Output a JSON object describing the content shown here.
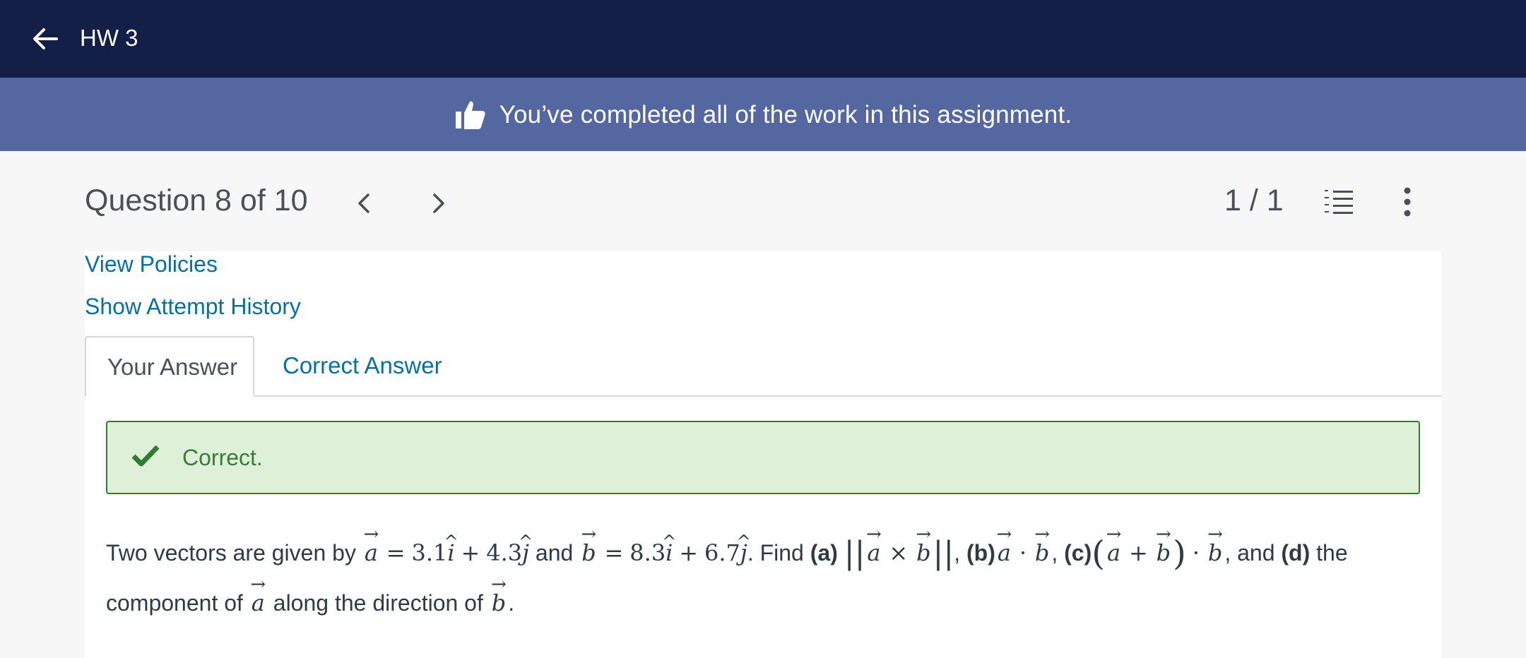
{
  "topbar": {
    "title": "HW 3",
    "back_icon": "arrow-left-icon"
  },
  "banner": {
    "text": "You’ve completed all of the work in this assignment.",
    "icon": "thumbs-up-icon",
    "bg": "#5567a1"
  },
  "question_header": {
    "title": "Question 8 of 10",
    "score": "1 / 1",
    "icons": [
      "chevron-left-icon",
      "chevron-right-icon",
      "numbered-list-icon",
      "more-vertical-icon"
    ]
  },
  "links": {
    "policies": "View Policies",
    "history": "Show Attempt History"
  },
  "tabs": {
    "your_answer": "Your Answer",
    "correct_answer": "Correct Answer"
  },
  "alert": {
    "text": "Correct.",
    "icon": "check-icon",
    "color": "#3a7d35"
  },
  "question": {
    "intro": "Two vectors are given by",
    "a_vec": "a",
    "eq": "=",
    "a_x": "3.1",
    "i": "i",
    "plus": "+",
    "a_y": "4.3",
    "j": "j",
    "and": "and",
    "b_vec": "b",
    "b_x": "8.3",
    "b_y": "6.7",
    "find": ". Find",
    "part_a": "(a)",
    "cross": "×",
    "part_b": "(b)",
    "dot": "·",
    "part_c": "(c)",
    "and_d": ", and",
    "part_d": "(d)",
    "tail": "the component of",
    "along": "along the direction of"
  },
  "colors": {
    "topbar": "#141f47",
    "link": "#0770a3",
    "alert_bg": "#dff0d8",
    "alert_border": "#2e7d32"
  }
}
